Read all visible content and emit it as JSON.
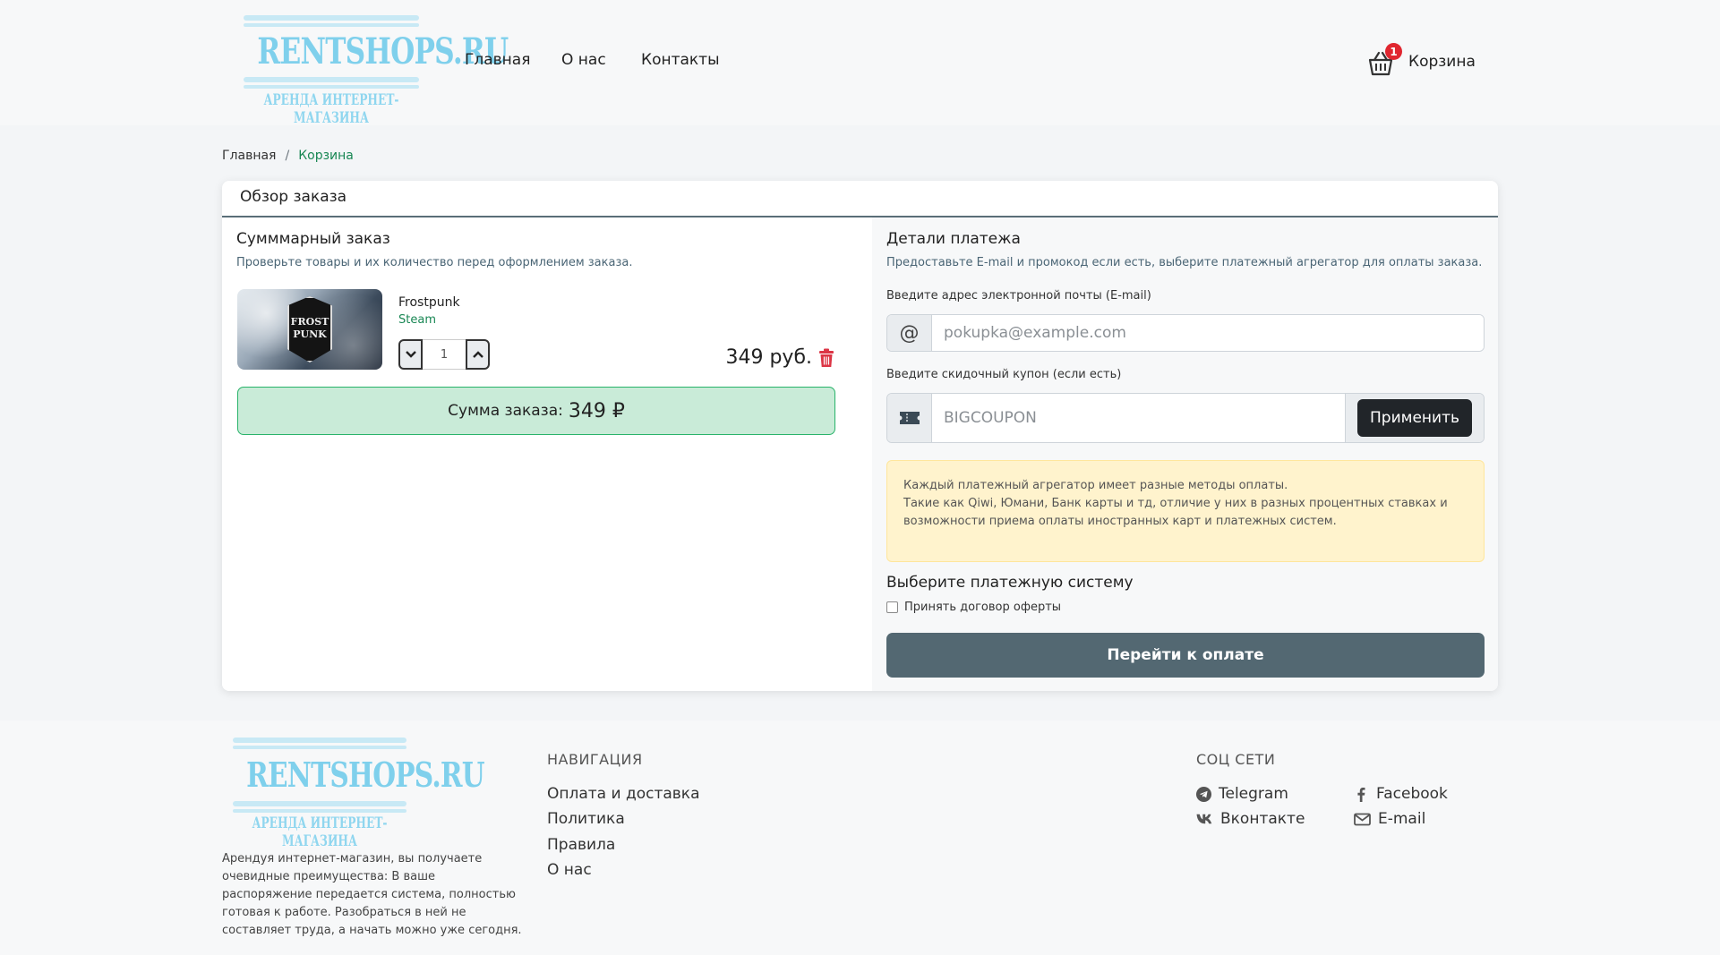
{
  "header": {
    "logo": {
      "brand": "RENTSHOPS.RU",
      "subtitle": "АРЕНДА ИНТЕРНЕТ-МАГАЗИНА"
    },
    "nav": [
      "Главная",
      "О нас",
      "Контакты"
    ],
    "cart": {
      "label": "Корзина",
      "count": "1"
    }
  },
  "breadcrumb": {
    "home": "Главная",
    "separator": "/",
    "current": "Корзина"
  },
  "card": {
    "title": "Обзор заказа",
    "summary": {
      "title": "Сумммарный заказ",
      "subtitle": "Проверьте товары и их количество перед оформлением заказа.",
      "product": {
        "name": "Frostpunk",
        "platform": "Steam",
        "quantity": "1",
        "price": "349 руб.",
        "image_emblem": "FROST PUNK"
      },
      "total_label": "Сумма заказа:",
      "total_value": "349 ₽"
    },
    "payment": {
      "title": "Детали платежа",
      "subtitle": "Предоставьте E-mail и промокод если есть, выберите платежный агрегатор для оплаты заказа.",
      "email_label": "Введите адрес электронной почты (E-mail)",
      "email_placeholder": "pokupka@example.com",
      "coupon_label": "Введите скидочный купон (если есть)",
      "coupon_placeholder": "BIGCOUPON",
      "apply_button": "Применить",
      "notice": [
        "Каждый платежный агрегатор имеет разные методы оплаты.",
        "Такие как Qiwi, Юмани, Банк карты и тд, отличие у них в разных процентных ставках и",
        "возможности приема оплаты иностранных карт и платежных систем."
      ],
      "system_title": "Выберите платежную систему",
      "agree_label": "Принять договор оферты",
      "pay_button": "Перейти к оплате"
    }
  },
  "footer": {
    "description": "Арендуя интернет-магазин, вы получаете очевидные преимущества: В ваше распоряжение передается система, полностью готовая к работе. Разобраться в ней не составляет труда, а начать можно уже сегодня.",
    "nav_title": "НАВИГАЦИЯ",
    "nav": [
      "Оплата и доставка",
      "Политика",
      "Правила",
      "О нас"
    ],
    "social_title": "СОЦ СЕТИ",
    "social": {
      "telegram": "Telegram",
      "facebook": "Facebook",
      "vk": "Вконтакте",
      "email": "E-mail"
    }
  },
  "colors": {
    "accent_green": "#198754",
    "badge_red": "#e0262f",
    "pay_button": "#536872",
    "total_bg": "#c9ebd8",
    "notice_bg": "#fff3cd"
  }
}
